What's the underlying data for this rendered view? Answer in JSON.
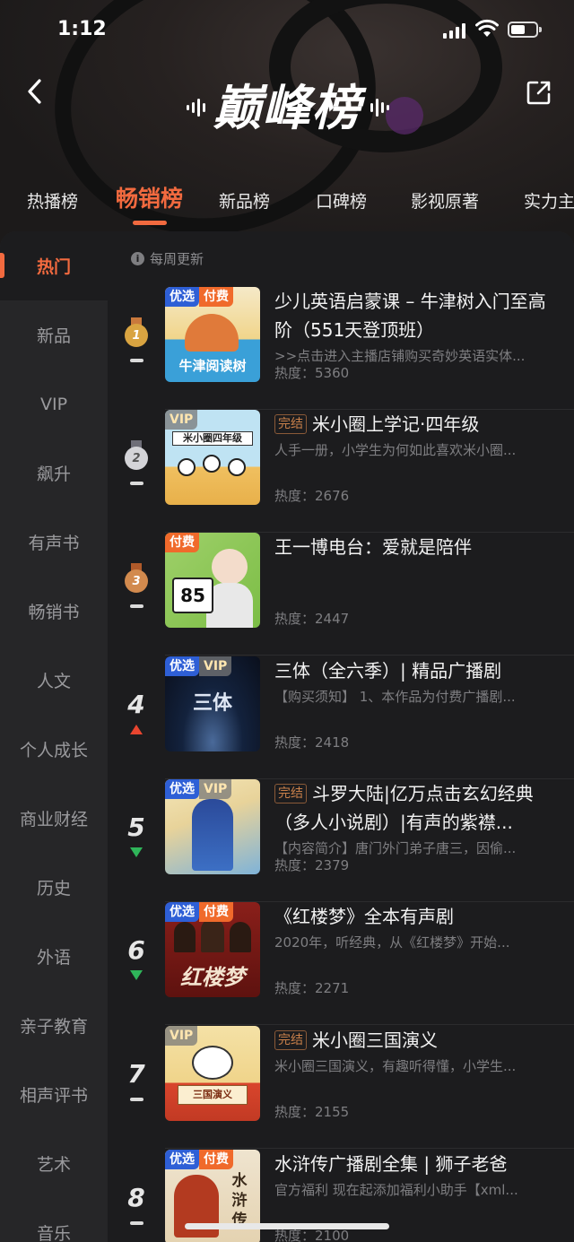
{
  "status_bar": {
    "time": "1:12"
  },
  "header": {
    "title": "巅峰榜"
  },
  "tabs": [
    {
      "label": "热播榜"
    },
    {
      "label": "畅销榜",
      "active": true
    },
    {
      "label": "新品榜"
    },
    {
      "label": "口碑榜"
    },
    {
      "label": "影视原著"
    },
    {
      "label": "实力主"
    }
  ],
  "sidebar": {
    "items": [
      {
        "label": "热门",
        "active": true
      },
      {
        "label": "新品"
      },
      {
        "label": "VIP"
      },
      {
        "label": "飙升"
      },
      {
        "label": "有声书"
      },
      {
        "label": "畅销书"
      },
      {
        "label": "人文"
      },
      {
        "label": "个人成长"
      },
      {
        "label": "商业财经"
      },
      {
        "label": "历史"
      },
      {
        "label": "外语"
      },
      {
        "label": "亲子教育"
      },
      {
        "label": "相声评书"
      },
      {
        "label": "艺术"
      },
      {
        "label": "音乐"
      }
    ]
  },
  "content": {
    "update_note": "每周更新",
    "items": [
      {
        "rank": "1",
        "trend": "flat",
        "tags": [
          "优选",
          "付费"
        ],
        "done": false,
        "title": "少儿英语启蒙课 – 牛津树入门至高阶（551天登顶班）",
        "desc": ">>点击进入主播店铺购买奇妙英语实体...",
        "heat": "热度：5360",
        "cover_text": "牛津阅读树"
      },
      {
        "rank": "2",
        "trend": "flat",
        "tags": [
          "VIP"
        ],
        "done": true,
        "done_label": "完结",
        "title": "米小圈上学记·四年级",
        "desc": "人手一册，小学生为何如此喜欢米小圈...",
        "heat": "热度：2676",
        "cover_text": "米小圈四年级"
      },
      {
        "rank": "3",
        "trend": "flat",
        "tags": [
          "付费"
        ],
        "done": false,
        "title": "王一博电台：爱就是陪伴",
        "desc": "",
        "heat": "热度：2447",
        "cover_text": "85"
      },
      {
        "rank": "4",
        "trend": "up",
        "tags": [
          "优选",
          "VIP"
        ],
        "done": false,
        "title": "三体（全六季）| 精品广播剧",
        "desc": "【购买须知】 1、本作品为付费广播剧...",
        "heat": "热度：2418",
        "cover_text": "三体"
      },
      {
        "rank": "5",
        "trend": "down",
        "tags": [
          "优选",
          "VIP"
        ],
        "done": true,
        "done_label": "完结",
        "title": "斗罗大陆|亿万点击玄幻经典（多人小说剧）|有声的紫襟...",
        "desc": "【内容简介】唐门外门弟子唐三，因偷...",
        "heat": "热度：2379",
        "cover_text": ""
      },
      {
        "rank": "6",
        "trend": "down",
        "tags": [
          "优选",
          "付费"
        ],
        "done": false,
        "title": "《红楼梦》全本有声剧",
        "desc": "2020年，听经典，从《红楼梦》开始...",
        "heat": "热度：2271",
        "cover_text": "红楼梦"
      },
      {
        "rank": "7",
        "trend": "flat",
        "tags": [
          "VIP"
        ],
        "done": true,
        "done_label": "完结",
        "title": "米小圈三国演义",
        "desc": "米小圈三国演义，有趣听得懂，小学生...",
        "heat": "热度：2155",
        "cover_text": "三国演义"
      },
      {
        "rank": "8",
        "trend": "flat",
        "tags": [
          "优选",
          "付费"
        ],
        "done": false,
        "title": "水浒传广播剧全集 | 狮子老爸",
        "desc": "官方福利  现在起添加福利小助手【xml...",
        "heat": "热度：2100",
        "cover_text": "水浒传"
      }
    ]
  },
  "colors": {
    "accent": "#f26a3f",
    "gold": "#d9a441",
    "silver": "#b8b8bc",
    "bronze": "#c9793c",
    "up": "#e8452f",
    "down": "#2fb55a"
  }
}
